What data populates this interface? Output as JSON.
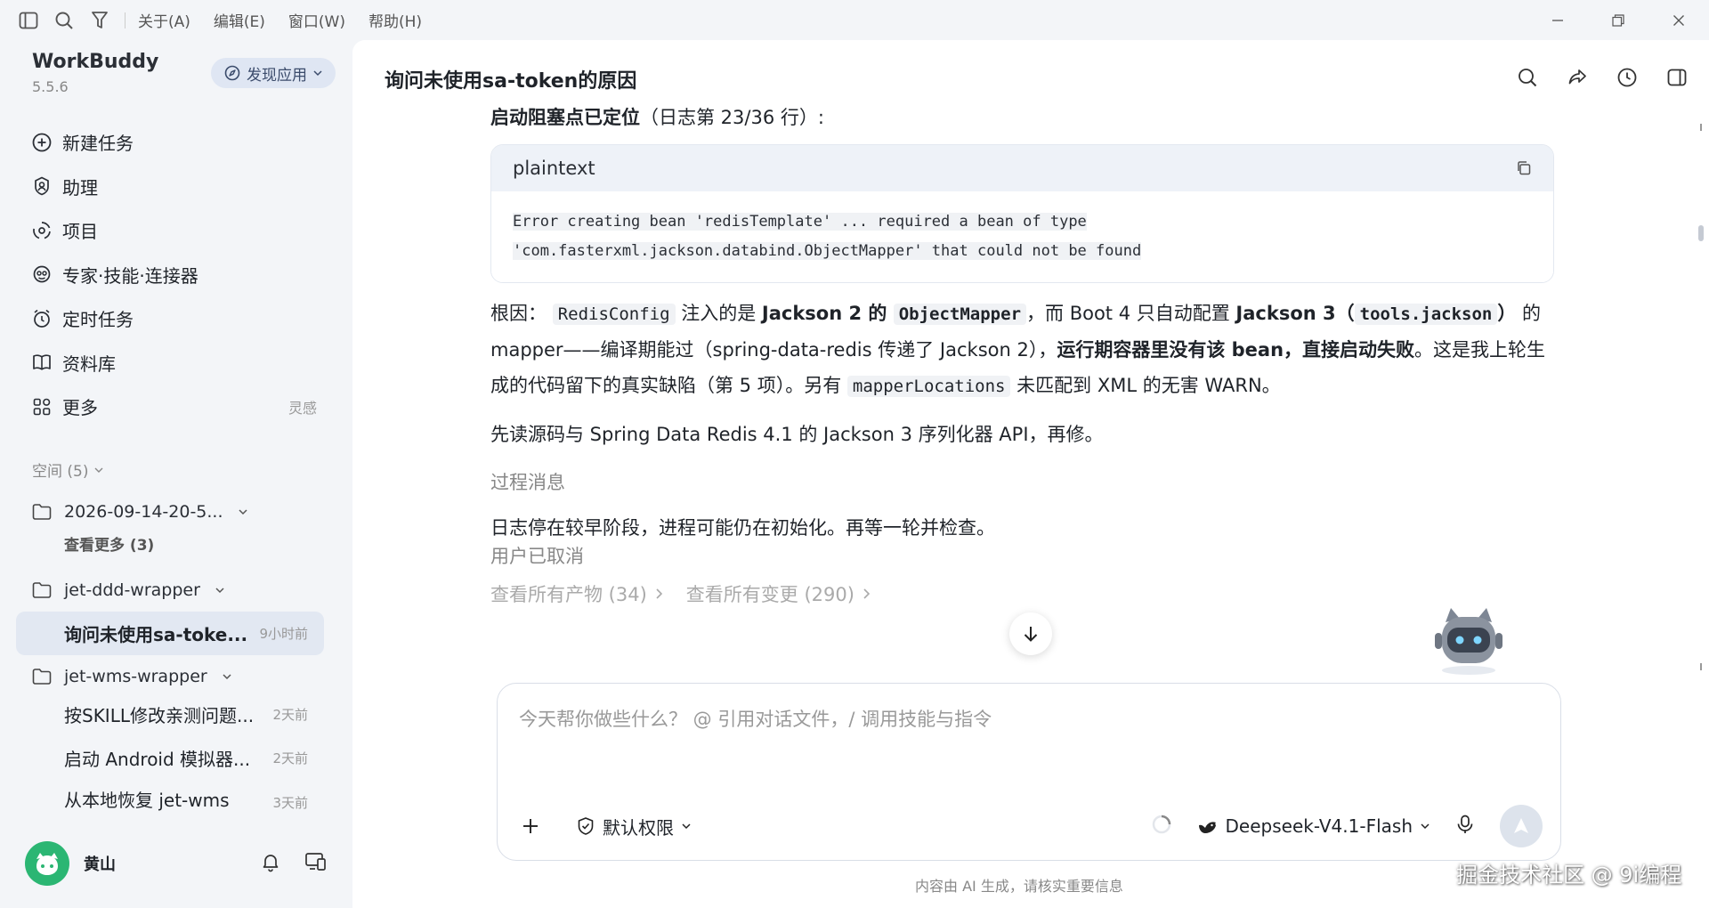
{
  "titlebar": {
    "menus": [
      "关于(A)",
      "编辑(E)",
      "窗口(W)",
      "帮助(H)"
    ]
  },
  "sidebar": {
    "brand": "WorkBuddy",
    "version": "5.5.6",
    "discover_label": "发现应用",
    "nav": [
      {
        "label": "新建任务",
        "icon": "plus-circle-icon"
      },
      {
        "label": "助理",
        "icon": "assistant-icon"
      },
      {
        "label": "项目",
        "icon": "project-icon"
      },
      {
        "label": "专家·技能·连接器",
        "icon": "expert-icon"
      },
      {
        "label": "定时任务",
        "icon": "alarm-icon"
      },
      {
        "label": "资料库",
        "icon": "book-icon"
      },
      {
        "label": "更多",
        "icon": "grid-icon",
        "extra": "灵感"
      }
    ],
    "space_label": "空间 (5)",
    "tree": {
      "folder1": "2026-09-14-20-5...",
      "see_more": "查看更多 (3)",
      "folder2": "jet-ddd-wrapper",
      "task_active": {
        "title": "询问未使用sa-toke...",
        "time": "9小时前"
      },
      "folder3": "jet-wms-wrapper",
      "tasks": [
        {
          "title": "按SKILL修改亲测问题...",
          "time": "2天前"
        },
        {
          "title": "启动 Android 模拟器...",
          "time": "2天前"
        },
        {
          "title": "从本地恢复 jet-wms",
          "time": "3天前"
        }
      ]
    },
    "user_name": "黄山"
  },
  "main": {
    "title": "询问未使用sa-token的原因",
    "heading_bold": "启动阻塞点已定位",
    "heading_rest": "（日志第 23/36 行）:",
    "code_lang": "plaintext",
    "code_line1": "Error creating bean 'redisTemplate' ... required a bean of type",
    "code_line2": "'com.fasterxml.jackson.databind.ObjectMapper' that could not be found",
    "para1": {
      "t1": "根因：",
      "c1": "RedisConfig",
      "t2": " 注入的是 ",
      "b1": "Jackson 2 的 ",
      "c2": "ObjectMapper",
      "t3": "，而 Boot 4 只自动配置 ",
      "b2": "Jackson 3（",
      "c3": "tools.jackson",
      "b3": "）",
      "t4": " 的 mapper——编译期能过（spring-data-redis 传递了 Jackson 2），",
      "b4": "运行期容器里没有该 bean，直接启动失败",
      "t5": "。这是我上轮生成的代码留下的真实缺陷（第 5 项）。另有 ",
      "c4": "mapperLocations",
      "t6": " 未匹配到 XML 的无害 WARN。"
    },
    "para2": "先读源码与 Spring Data Redis 4.1 的 Jackson 3 序列化器 API，再修。",
    "process_msg": "过程消息",
    "para3": "日志停在较早阶段，进程可能仍在初始化。再等一轮并检查。",
    "cancelled": "用户已取消",
    "link_artifacts": "查看所有产物 (34)",
    "link_changes": "查看所有变更 (290)"
  },
  "composer": {
    "placeholder": "今天帮你做些什么？ @ 引用对话文件，/ 调用技能与指令",
    "permission_label": "默认权限",
    "model_label": "Deepseek-V4.1-Flash"
  },
  "footer_note": "内容由 AI 生成，请核实重要信息",
  "watermark": "掘金技术社区 @ 9i编程"
}
